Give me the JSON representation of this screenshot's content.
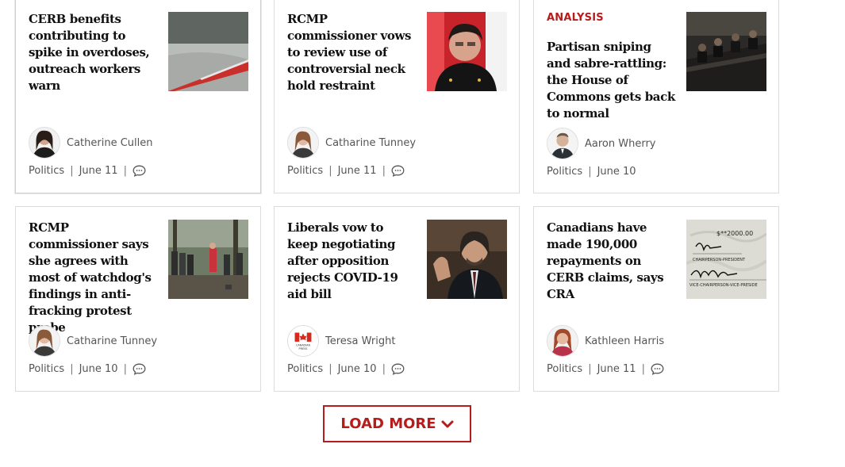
{
  "cards": [
    {
      "label": "",
      "headline": "CERB benefits contributing to spike in overdoses, outreach workers warn",
      "author": "Catherine Cullen",
      "section": "Politics",
      "date": "June 11",
      "image": "overdose-syringe-photo"
    },
    {
      "label": "",
      "headline": "RCMP commissioner vows to review use of controversial neck hold restraint",
      "author": "Catharine Tunney",
      "section": "Politics",
      "date": "June 11",
      "image": "rcmp-commissioner-photo"
    },
    {
      "label": "ANALYSIS",
      "headline": "Partisan sniping and sabre-rattling: the House of Commons gets back to normal",
      "author": "Aaron Wherry",
      "section": "Politics",
      "date": "June 10",
      "image": "house-of-commons-photo"
    },
    {
      "label": "",
      "headline": "RCMP commissioner says she agrees with most of watchdog's findings in anti-fracking protest probe",
      "author": "Catharine Tunney",
      "section": "Politics",
      "date": "June 10",
      "image": "protest-forest-photo"
    },
    {
      "label": "",
      "headline": "Liberals vow to keep negotiating after opposition rejects COVID-19 aid bill",
      "author": "Teresa Wright",
      "author_logo_text": "CANADIAN PRESS",
      "section": "Politics",
      "date": "June 10",
      "image": "liberal-minister-photo"
    },
    {
      "label": "",
      "headline": "Canadians have made 190,000 repayments on CERB claims, says CRA",
      "author": "Kathleen Harris",
      "section": "Politics",
      "date": "June 11",
      "image": "cheque-signature-photo",
      "image_text": {
        "amount": "$**2000.00",
        "line1": "CHAIRPERSON-PRESIDENT",
        "line2": "VICE-CHAIRPERSON-VICE-PRESIDE"
      }
    }
  ],
  "load_more": {
    "label": "LOAD MORE"
  },
  "colors": {
    "accent": "#b71c1c",
    "meta_text": "#555555",
    "border": "#dcdcdc"
  },
  "icons": {
    "comment": "comment-bubble-icon",
    "load_more_chevron": "chevron-down-icon"
  }
}
